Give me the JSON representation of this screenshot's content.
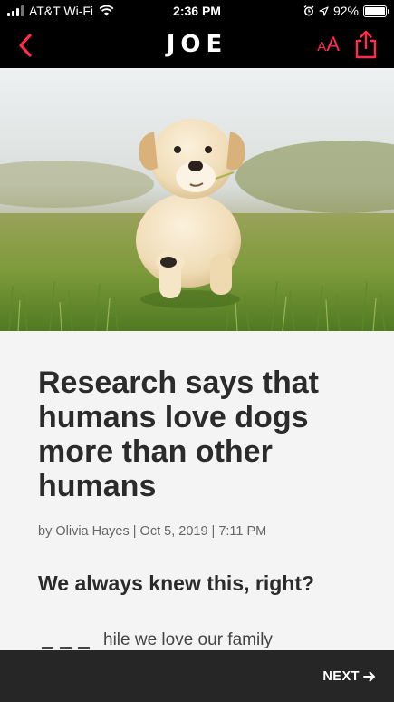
{
  "status_bar": {
    "carrier": "AT&T Wi-Fi",
    "time": "2:36 PM",
    "battery": "92%",
    "battery_level": 0.92,
    "icons": [
      "signal-icon",
      "wifi-icon",
      "alarm-icon",
      "location-icon",
      "battery-icon"
    ]
  },
  "nav": {
    "logo": "JOE",
    "font_size_small": "A",
    "font_size_large": "A",
    "icons": [
      "back-chevron-icon",
      "font-size-icon",
      "share-icon"
    ],
    "accent_color": "#ff2e4d"
  },
  "hero": {
    "image": "golden-retriever-puppy-running-in-grass"
  },
  "article": {
    "title": "Research says that humans love dogs more than other humans",
    "byline": "by Olivia Hayes | Oct 5, 2019 | 7:11 PM",
    "subheading": "We always knew this, right?",
    "body_partial": "hile we love our family"
  },
  "bottom_bar": {
    "next_label": "NEXT",
    "next_icon": "arrow-right-icon"
  }
}
